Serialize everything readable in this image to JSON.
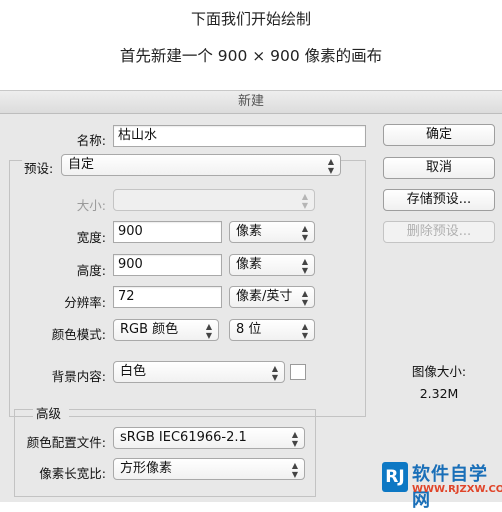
{
  "captions": {
    "line1": "下面我们开始绘制",
    "line2": "首先新建一个 900 × 900 像素的画布"
  },
  "dialog": {
    "title": "新建",
    "name_label": "名称:",
    "name_value": "枯山水",
    "preset_label": "预设:",
    "preset_value": "自定",
    "size_label": "大小:",
    "size_value": "",
    "width_label": "宽度:",
    "width_value": "900",
    "width_unit": "像素",
    "height_label": "高度:",
    "height_value": "900",
    "height_unit": "像素",
    "resolution_label": "分辨率:",
    "resolution_value": "72",
    "resolution_unit": "像素/英寸",
    "color_mode_label": "颜色模式:",
    "color_mode_value": "RGB 颜色",
    "bit_depth_value": "8 位",
    "background_label": "背景内容:",
    "background_value": "白色",
    "background_swatch_color": "#ffffff",
    "advanced_label": "高级",
    "color_profile_label": "颜色配置文件:",
    "color_profile_value": "sRGB IEC61966-2.1",
    "pixel_aspect_label": "像素长宽比:",
    "pixel_aspect_value": "方形像素",
    "image_size_label": "图像大小:",
    "image_size_value": "2.32M"
  },
  "buttons": {
    "ok": "确定",
    "cancel": "取消",
    "save_preset": "存储预设...",
    "delete_preset": "删除预设..."
  },
  "watermark": {
    "logo": "RJ",
    "name": "软件自学网",
    "url": "WWW.RJZXW.COM"
  },
  "colors": {
    "dialog_bg": "#e8e8e8",
    "watermark_blue": "#1a6fb8",
    "watermark_red": "#e0452a"
  }
}
